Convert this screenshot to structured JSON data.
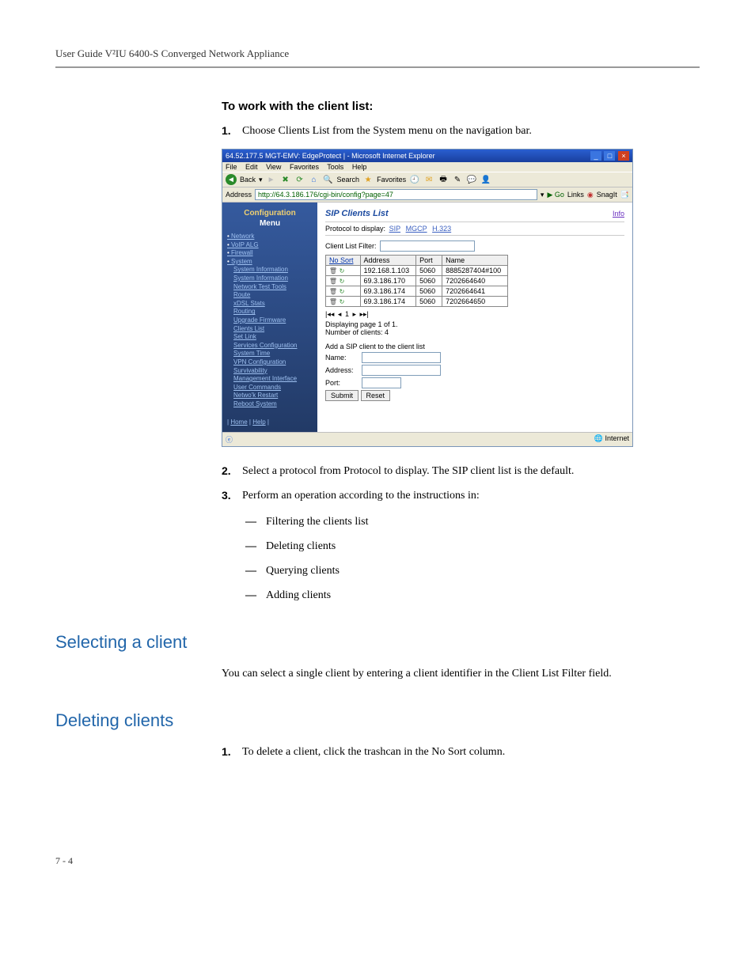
{
  "doc_header": "User Guide V²IU 6400-S Converged Network Appliance",
  "subheading1": "To work with the client list:",
  "step1_num": "1.",
  "step1_text": "Choose Clients List from the System menu on the navigation bar.",
  "step2_num": "2.",
  "step2_text": "Select a protocol from Protocol to display. The SIP client list is the default.",
  "step3_num": "3.",
  "step3_text": "Perform an operation according to the instructions in:",
  "dash": "—",
  "bullet_a": "Filtering the clients list",
  "bullet_b": "Deleting clients",
  "bullet_c": "Querying clients",
  "bullet_d": "Adding clients",
  "section_selecting": "Selecting a client",
  "selecting_body": "You can select a single client by entering a client identifier in the Client List Filter field.",
  "section_deleting": "Deleting clients",
  "del_step1_num": "1.",
  "del_step1_text": "To delete a client, click the trashcan in the No Sort column.",
  "page_number": "7 - 4",
  "screenshot": {
    "window_title": "64.52.177.5 MGT-EMV: EdgeProtect | - Microsoft Internet Explorer",
    "menubar": {
      "file": "File",
      "edit": "Edit",
      "view": "View",
      "favorites": "Favorites",
      "tools": "Tools",
      "help": "Help"
    },
    "toolbar": {
      "back": "Back",
      "search": "Search",
      "favorites": "Favorites"
    },
    "address_label": "Address",
    "address_value": "http://64.3.186.176/cgi-bin/config?page=47",
    "go": "Go",
    "links": "Links",
    "snagit": "SnagIt",
    "sidebar": {
      "cfg": "Configuration",
      "menu": "Menu",
      "items": {
        "network": "Network",
        "voipalg": "VoIP ALG",
        "firewall": "Firewall",
        "system": "System",
        "sysinfo": "System Information",
        "systemInfo2": "System Information",
        "nettest": "Network Test Tools",
        "route": "Route",
        "t1stats": "xDSL Stats",
        "routing": "Routing",
        "upgrade": "Upgrade Firmware",
        "clients": "Clients List",
        "setlink": "Set Link",
        "services": "Services Configuration",
        "systime": "System Time",
        "vpncfg": "VPN Configuration",
        "surv": "Survivability",
        "mgmtif": "Management Interface",
        "usercmd": "User Commands",
        "netrestart": "Netwo'k Restart",
        "reboot": "Reboot System"
      },
      "home": "Home",
      "help": "Help"
    },
    "main": {
      "title": "SIP Clients List",
      "info": "Info",
      "proto_label": "Protocol to display:",
      "proto_sip": "SIP",
      "proto_mgcp": "MGCP",
      "proto_h323": "H.323",
      "filter_label": "Client List Filter:",
      "cols": {
        "nosort": "No Sort",
        "address": "Address",
        "port": "Port",
        "name": "Name"
      },
      "rows": [
        {
          "address": "192.168.1.103",
          "port": "5060",
          "name": "8885287404#100"
        },
        {
          "address": "69.3.186.170",
          "port": "5060",
          "name": "7202664640"
        },
        {
          "address": "69.3.186.174",
          "port": "5060",
          "name": "7202664641"
        },
        {
          "address": "69.3.186.174",
          "port": "5060",
          "name": "7202664650"
        }
      ],
      "pager_first": "|◂◂",
      "pager_prev": "◂",
      "pager_current": "1",
      "pager_next": "▸",
      "pager_last": "▸▸|",
      "displaying": "Displaying page 1 of 1.",
      "numclients": "Number of clients: 4",
      "add_header": "Add a SIP client to the client list",
      "name_lbl": "Name:",
      "addr_lbl": "Address:",
      "port_lbl": "Port:",
      "submit": "Submit",
      "reset": "Reset"
    },
    "statusbar": {
      "left": "",
      "right": "Internet"
    }
  }
}
